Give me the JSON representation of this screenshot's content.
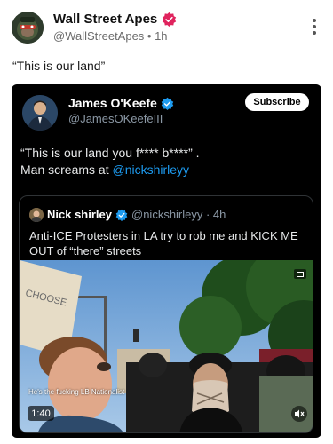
{
  "post": {
    "author_name": "Wall Street Apes",
    "author_meta": "@WallStreetApes • 1h",
    "text": "“This is our land”"
  },
  "tweet": {
    "author_name": "James O'Keefe",
    "handle": "@JamesOKeefeIII",
    "subscribe_label": "Subscribe",
    "text_line1": "“This is our land you f**** b****” .",
    "text_line2_prefix": "Man screams at ",
    "text_mention": "@nickshirleyy"
  },
  "quote": {
    "author_name": "Nick shirley",
    "meta": "@nickshirleyy · 4h",
    "text": "Anti-ICE Protesters in LA try to rob me and KICK ME OUT of “there” streets",
    "video": {
      "caption": "He's the fucking LB Nationalist",
      "duration": "1:40",
      "sign_text": "CHOOSE"
    }
  },
  "colors": {
    "verified_blue": "#1d9bf0",
    "badge_red": "#e0245e",
    "card_bg": "#000000",
    "mention": "#1d9bf0"
  }
}
